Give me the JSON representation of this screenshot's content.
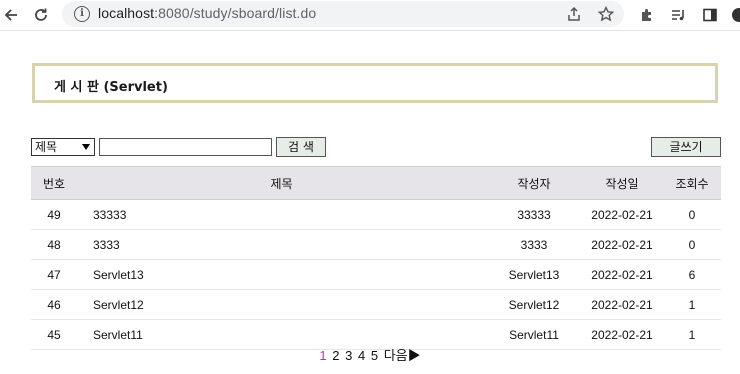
{
  "browser": {
    "url_host": "localhost",
    "url_rest": ":8080/study/sboard/list.do"
  },
  "board": {
    "title": "게 시 판 (Servlet)",
    "search": {
      "field_selected": "제목",
      "input_value": "",
      "button_label": "검 색"
    },
    "write_button": "글쓰기",
    "columns": [
      "번호",
      "제목",
      "작성자",
      "작성일",
      "조회수"
    ],
    "rows": [
      {
        "no": "49",
        "title": "33333",
        "writer": "33333",
        "date": "2022-02-21",
        "hits": "0"
      },
      {
        "no": "48",
        "title": "3333",
        "writer": "3333",
        "date": "2022-02-21",
        "hits": "0"
      },
      {
        "no": "47",
        "title": "Servlet13",
        "writer": "Servlet13",
        "date": "2022-02-21",
        "hits": "6"
      },
      {
        "no": "46",
        "title": "Servlet12",
        "writer": "Servlet12",
        "date": "2022-02-21",
        "hits": "1"
      },
      {
        "no": "45",
        "title": "Servlet11",
        "writer": "Servlet11",
        "date": "2022-02-21",
        "hits": "1"
      }
    ],
    "paging": {
      "current": "1",
      "pages": [
        "2",
        "3",
        "4",
        "5"
      ],
      "next_label": "다음▶"
    }
  },
  "colors": {
    "title_border": "#d7d3b0",
    "header_bg": "#e6e4e8",
    "current_page": "#d61fc7",
    "button_bg": "#e6ede6"
  }
}
